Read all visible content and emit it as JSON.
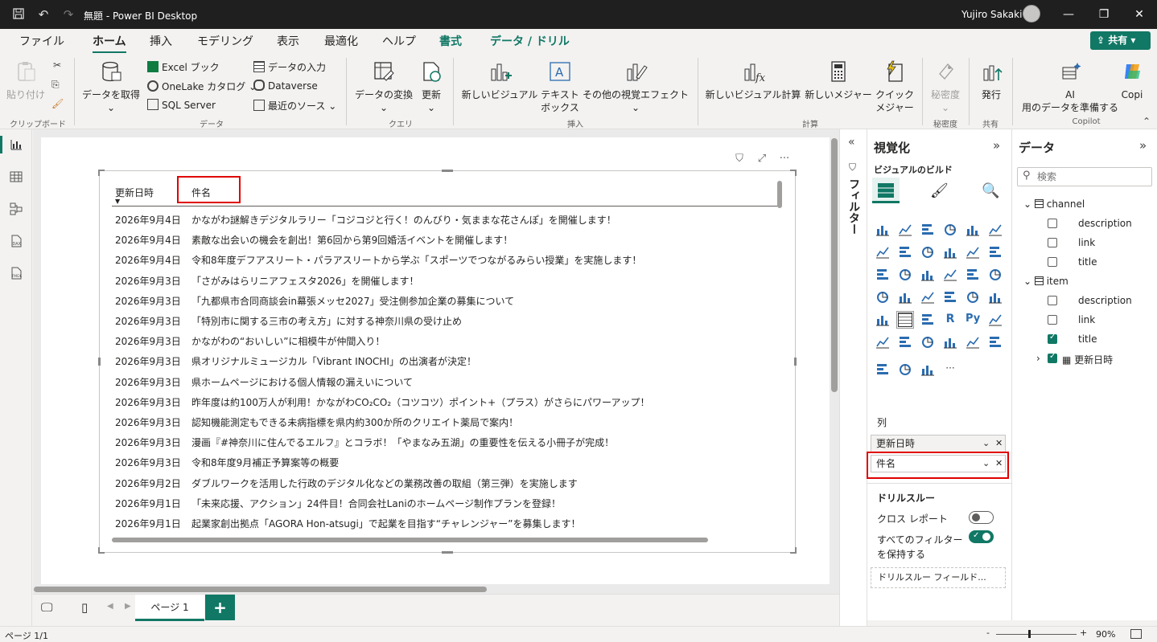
{
  "window": {
    "title": "無題 - Power BI Desktop",
    "user": "Yujiro Sakaki"
  },
  "menu": {
    "tabs": [
      "ファイル",
      "ホーム",
      "挿入",
      "モデリング",
      "表示",
      "最適化",
      "ヘルプ",
      "書式",
      "データ / ドリル"
    ],
    "share": "共有"
  },
  "ribbon": {
    "clipboard": {
      "paste": "貼り付け",
      "label": "クリップボード"
    },
    "data": {
      "get_data": "データを取得",
      "excel": "Excel ブック",
      "onelake": "OneLake カタログ",
      "sql": "SQL Server",
      "enter": "データの入力",
      "dataverse": "Dataverse",
      "recent": "最近のソース",
      "label": "データ"
    },
    "query": {
      "transform": "データの変換",
      "refresh": "更新",
      "label": "クエリ"
    },
    "insert": {
      "new_visual": "新しいビジュアル",
      "textbox_1": "テキスト",
      "textbox_2": "ボックス",
      "more_visuals": "その他の視覚エフェクト",
      "label": "挿入"
    },
    "calc": {
      "new_visual_calc": "新しいビジュアル計算",
      "new_measure": "新しいメジャー",
      "quick_1": "クイック",
      "quick_2": "メジャー",
      "label": "計算"
    },
    "sensitivity": {
      "btn": "秘密度",
      "label": "秘密度"
    },
    "share": {
      "publish": "発行",
      "label": "共有"
    },
    "copilot": {
      "ai": "AI",
      "prepare": "用のデータを準備する",
      "copilot_btn": "Copi",
      "label": "Copilot"
    }
  },
  "table": {
    "col_date": "更新日時",
    "col_title": "件名",
    "rows": [
      {
        "date": "2026年9月4日",
        "title": "かながわ謎解きデジタルラリー「コジコジと行く！のんびり・気ままな花さんぽ」を開催します！"
      },
      {
        "date": "2026年9月4日",
        "title": "素敵な出会いの機会を創出！第6回から第9回婚活イベントを開催します！"
      },
      {
        "date": "2026年9月4日",
        "title": "令和8年度デフアスリート・パラアスリートから学ぶ「スポーツでつながるみらい授業」を実施します！"
      },
      {
        "date": "2026年9月3日",
        "title": "「さがみはらリニアフェスタ2026」を開催します！"
      },
      {
        "date": "2026年9月3日",
        "title": "「九都県市合同商談会in幕張メッセ2027」受注側参加企業の募集について"
      },
      {
        "date": "2026年9月3日",
        "title": "「特別市に関する三市の考え方」に対する神奈川県の受け止め"
      },
      {
        "date": "2026年9月3日",
        "title": "かながわの“おいしい”に相模牛が仲間入り！"
      },
      {
        "date": "2026年9月3日",
        "title": "県オリジナルミュージカル「Vibrant INOCHI」の出演者が決定！"
      },
      {
        "date": "2026年9月3日",
        "title": "県ホームページにおける個人情報の漏えいについて"
      },
      {
        "date": "2026年9月3日",
        "title": "昨年度は約100万人が利用！かながわCO₂CO₂（コツコツ）ポイント+（プラス）がさらにパワーアップ！"
      },
      {
        "date": "2026年9月3日",
        "title": "認知機能測定もできる未病指標を県内約300か所のクリエイト薬局で案内！"
      },
      {
        "date": "2026年9月3日",
        "title": "漫画『#神奈川に住んでるエルフ』とコラボ！「やまなみ五湖」の重要性を伝える小冊子が完成！"
      },
      {
        "date": "2026年9月3日",
        "title": "令和8年度9月補正予算案等の概要"
      },
      {
        "date": "2026年9月2日",
        "title": "ダブルワークを活用した行政のデジタル化などの業務改善の取組（第三弾）を実施します"
      },
      {
        "date": "2026年9月1日",
        "title": "「未来応援、アクション」24件目！合同会社Laniのホームページ制作プランを登録！"
      },
      {
        "date": "2026年9月1日",
        "title": "起業家創出拠点「AGORA Hon-atsugi」で起業を目指す“チャレンジャー”を募集します！"
      }
    ]
  },
  "filter_pane": {
    "label": "フィルター"
  },
  "viz_pane": {
    "title": "視覚化",
    "build": "ビジュアルのビルド",
    "columns_label": "列",
    "field1": "更新日時",
    "field2": "件名",
    "drill_label": "ドリルスルー",
    "cross_report": "クロス レポート",
    "keep_filters_1": "すべてのフィルター",
    "keep_filters_2": "を保持する",
    "drill_fields": "ドリルスルー フィールド..."
  },
  "data_pane": {
    "title": "データ",
    "search_placeholder": "検索",
    "tables": [
      {
        "name": "channel",
        "fields": [
          "description",
          "link",
          "title"
        ]
      },
      {
        "name": "item",
        "fields": [
          "description",
          "link",
          "title",
          "更新日時"
        ]
      }
    ]
  },
  "pages": {
    "page1": "ページ 1"
  },
  "status": {
    "page": "ページ 1/1",
    "zoom": "90%"
  },
  "colors": {
    "accent": "#117865",
    "highlight": "#e00000"
  }
}
